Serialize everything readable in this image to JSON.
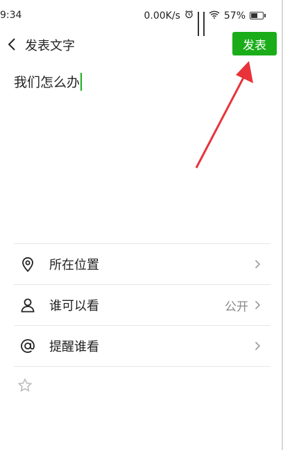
{
  "status_bar": {
    "time": "9:34",
    "network_speed": "0.00K/s",
    "battery": "57%"
  },
  "header": {
    "title": "发表文字",
    "publish_label": "发表"
  },
  "composer": {
    "text": "我们怎么办"
  },
  "options": [
    {
      "label": "所在位置",
      "value": "",
      "icon": "location-pin-icon"
    },
    {
      "label": "谁可以看",
      "value": "公开",
      "icon": "person-icon"
    },
    {
      "label": "提醒谁看",
      "value": "",
      "icon": "at-icon"
    }
  ],
  "colors": {
    "accent": "#1aad19",
    "annotation": "#e8333a"
  }
}
